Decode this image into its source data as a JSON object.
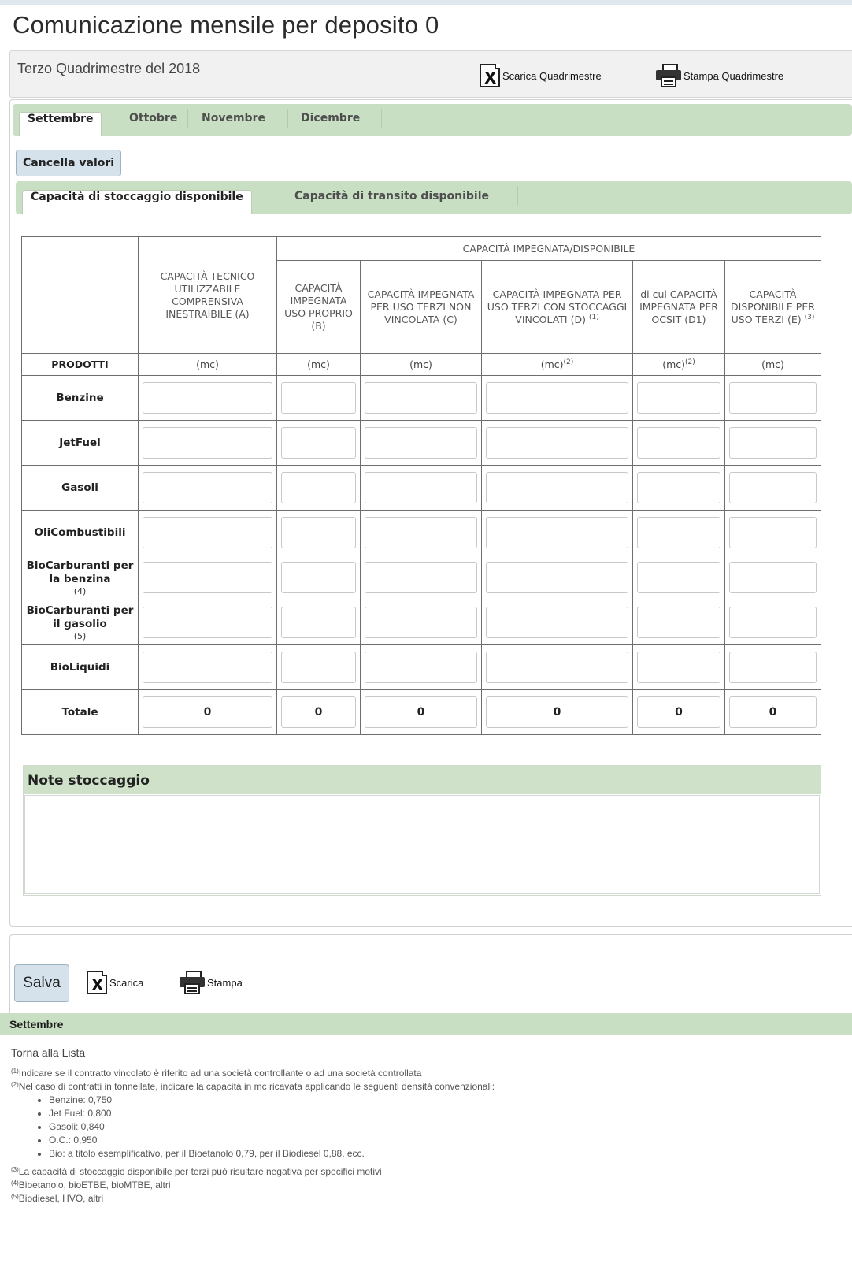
{
  "page": {
    "title": "Comunicazione mensile per deposito 0",
    "period": "Terzo Quadrimestre del 2018",
    "download_quadr_label": "Scarica Quadrimestre",
    "print_quadr_label": "Stampa Quadrimestre"
  },
  "icons": {
    "excel": "excel-download-icon",
    "printer": "printer-icon",
    "excel_glyph": "X"
  },
  "month_tabs": [
    "Settembre",
    "Ottobre",
    "Novembre",
    "Dicembre"
  ],
  "active_month": "Settembre",
  "clear_button_label": "Cancella valori",
  "sub_tabs": [
    "Capacità di stoccaggio disponibile",
    "Capacità di transito disponibile"
  ],
  "table": {
    "group_header": "CAPACITÀ IMPEGNATA/DISPONIBILE",
    "col_a": "CAPACITÀ TECNICO UTILIZZABILE COMPRENSIVA INESTRAIBILE (A)",
    "col_b": "CAPACITÀ IMPEGNATA USO PROPRIO (B)",
    "col_c": "CAPACITÀ IMPEGNATA PER USO TERZI NON VINCOLATA (C)",
    "col_d": "CAPACITÀ IMPEGNATA PER USO TERZI CON STOCCAGGI VINCOLATI (D)",
    "col_d_sup": "(1)",
    "col_d1": "di cui CAPACITÀ IMPEGNATA PER OCSIT (D1)",
    "col_e": "CAPACITÀ DISPONIBILE PER USO TERZI (E)",
    "col_e_sup": "(3)",
    "products_header": "PRODOTTI",
    "unit": "(mc)",
    "unit_sup": "(2)",
    "products": [
      {
        "name": "Benzine",
        "note": ""
      },
      {
        "name": "JetFuel",
        "note": ""
      },
      {
        "name": "Gasoli",
        "note": ""
      },
      {
        "name": "OliCombustibili",
        "note": ""
      },
      {
        "name": "BioCarburanti per la benzina",
        "note": "(4)"
      },
      {
        "name": "BioCarburanti per il gasolio",
        "note": "(5)"
      },
      {
        "name": "BioLiquidi",
        "note": ""
      }
    ],
    "total_label": "Totale",
    "totals": [
      "0",
      "0",
      "0",
      "0",
      "0",
      "0"
    ]
  },
  "notes": {
    "title": "Note stoccaggio",
    "value": ""
  },
  "bottom": {
    "save_label": "Salva",
    "download_label": "Scarica",
    "print_label": "Stampa",
    "month_label": "Settembre",
    "back_link": "Torna alla Lista"
  },
  "footnotes": {
    "n1_mark": "(1)",
    "n1": "Indicare se il contratto vincolato è riferito ad una società controllante o ad una società controllata",
    "n2_mark": "(2)",
    "n2": "Nel caso di contratti in tonnellate, indicare la capacità in mc ricavata applicando le seguenti densità convenzionali:",
    "densities": [
      "Benzine: 0,750",
      "Jet Fuel: 0,800",
      "Gasoli: 0,840",
      "O.C.: 0,950",
      "Bio: a titolo esemplificativo, per il Bioetanolo 0,79, per il Biodiesel 0,88, ecc."
    ],
    "n3_mark": "(3)",
    "n3": "La capacità di stoccaggio disponibile per terzi può risultare negativa per specifici motivi",
    "n4_mark": "(4)",
    "n4": "Bioetanolo, bioETBE, bioMTBE, altri",
    "n5_mark": "(5)",
    "n5": "Biodiesel, HVO, altri"
  }
}
